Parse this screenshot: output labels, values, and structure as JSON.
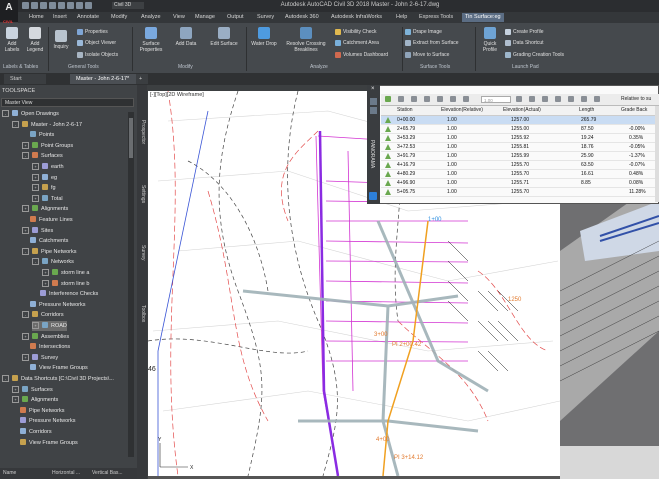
{
  "app": {
    "logo_text": "A",
    "logo_sub": "CIVIL",
    "qat_title": "Civil 3D",
    "title": "Autodesk AutoCAD Civil 3D 2018    Master - John 2-6-17.dwg"
  },
  "ribbon_tabs": [
    "Home",
    "Insert",
    "Annotate",
    "Modify",
    "Analyze",
    "View",
    "Manage",
    "Output",
    "Survey",
    "Autodesk 360",
    "Autodesk InfraWorks",
    "Help",
    "Express Tools",
    "Tin Surface:eg",
    ""
  ],
  "ribbon": {
    "add_labels": "Add Labels",
    "add_legend": "Add Legend",
    "inquiry": "Inquiry",
    "properties": "Properties",
    "object_viewer": "Object Viewer",
    "isolate_objects": "Isolate Objects",
    "surface_properties": "Surface Properties",
    "add_data": "Add Data",
    "edit_surface": "Edit Surface",
    "water_drop": "Water Drop",
    "resolve_crossing": "Resolve Crossing Breaklines",
    "visibility_check": "Visibility Check",
    "catchment_area": "Catchment Area",
    "volumes_dashboard": "Volumes Dashboard",
    "drape_image": "Drape Image",
    "extract_from_surface": "Extract from Surface",
    "move_to_surface": "Move to Surface",
    "quick_profile": "Quick Profile",
    "create_profile": "Create Profile",
    "data_shortcut": "Data Shortcut",
    "grading_creation": "Grading Creation Tools",
    "panels": {
      "labels_tables": "Labels & Tables",
      "general_tools": "General Tools",
      "modify": "Modify",
      "analyze": "Analyze",
      "surface_tools": "Surface Tools",
      "launch_pad": "Launch Pad"
    }
  },
  "doc_tabs": [
    "Start",
    "Master - John 2-6-17*",
    "+"
  ],
  "toolspace": {
    "title": "TOOLSPACE",
    "view": "Master View",
    "vtabs": [
      "Prospector",
      "Settings",
      "Survey",
      "Toolbox"
    ],
    "tree": [
      {
        "label": "Open Drawings",
        "indent": 0,
        "exp": "-"
      },
      {
        "label": "Master - John 2-6-17",
        "indent": 1,
        "exp": "-"
      },
      {
        "label": "Points",
        "indent": 2,
        "exp": ""
      },
      {
        "label": "Point Groups",
        "indent": 2,
        "exp": "+"
      },
      {
        "label": "Surfaces",
        "indent": 2,
        "exp": "-"
      },
      {
        "label": "earth",
        "indent": 3,
        "exp": "+"
      },
      {
        "label": "eg",
        "indent": 3,
        "exp": "+"
      },
      {
        "label": "fg",
        "indent": 3,
        "exp": "+"
      },
      {
        "label": "Total",
        "indent": 3,
        "exp": "+"
      },
      {
        "label": "Alignments",
        "indent": 2,
        "exp": "+"
      },
      {
        "label": "Feature Lines",
        "indent": 2,
        "exp": ""
      },
      {
        "label": "Sites",
        "indent": 2,
        "exp": "+"
      },
      {
        "label": "Catchments",
        "indent": 2,
        "exp": ""
      },
      {
        "label": "Pipe Networks",
        "indent": 2,
        "exp": "-"
      },
      {
        "label": "Networks",
        "indent": 3,
        "exp": "-"
      },
      {
        "label": "storm line a",
        "indent": 4,
        "exp": "+"
      },
      {
        "label": "storm line b",
        "indent": 4,
        "exp": "+"
      },
      {
        "label": "Interference Checks",
        "indent": 3,
        "exp": ""
      },
      {
        "label": "Pressure Networks",
        "indent": 2,
        "exp": ""
      },
      {
        "label": "Corridors",
        "indent": 2,
        "exp": "-"
      },
      {
        "label": "ROAD",
        "indent": 3,
        "exp": "+",
        "selected": true
      },
      {
        "label": "Assemblies",
        "indent": 2,
        "exp": "+"
      },
      {
        "label": "Intersections",
        "indent": 2,
        "exp": ""
      },
      {
        "label": "Survey",
        "indent": 2,
        "exp": "+"
      },
      {
        "label": "View Frame Groups",
        "indent": 2,
        "exp": ""
      },
      {
        "label": "Data Shortcuts [C:\\Civil 3D Projects\\...",
        "indent": 0,
        "exp": "-"
      },
      {
        "label": "Surfaces",
        "indent": 1,
        "exp": "+"
      },
      {
        "label": "Alignments",
        "indent": 1,
        "exp": "+"
      },
      {
        "label": "Pipe Networks",
        "indent": 1,
        "exp": ""
      },
      {
        "label": "Pressure Networks",
        "indent": 1,
        "exp": ""
      },
      {
        "label": "Corridors",
        "indent": 1,
        "exp": ""
      },
      {
        "label": "View Frame Groups",
        "indent": 1,
        "exp": ""
      }
    ],
    "bottom_cols": [
      "Name",
      "Horizontal ...",
      "Vertical Bas..."
    ]
  },
  "viewport": {
    "label": "[-][Top][2D Wireframe]",
    "coords": [
      "1250",
      "1255",
      "1260",
      "46",
      "3+00",
      "1+00",
      "4+00",
      "2+00",
      "PI 3+14.12",
      "PI 2+00.42"
    ]
  },
  "panorama": {
    "title": "PANORAMA",
    "search_placeholder": "1.00",
    "relative_label": "Relative to su",
    "columns": [
      "Station",
      "Elevation(Relative)",
      "Elevation(Actual)",
      "Length",
      "Grade Back"
    ],
    "rows": [
      [
        "0+00.00",
        "1.00",
        "1257.00",
        "265.79",
        ""
      ],
      [
        "2+65.79",
        "1.00",
        "1255.00",
        "87.50",
        "-0.00%"
      ],
      [
        "3+53.29",
        "1.00",
        "1255.92",
        "19.24",
        "0.35%"
      ],
      [
        "3+72.53",
        "1.00",
        "1255.81",
        "18.76",
        "-0.05%"
      ],
      [
        "3+91.79",
        "1.00",
        "1255.99",
        "25.90",
        "-1.37%"
      ],
      [
        "4+16.79",
        "1.00",
        "1255.70",
        "63.50",
        "-0.07%"
      ],
      [
        "4+80.29",
        "1.00",
        "1255.70",
        "16.61",
        "0.48%"
      ],
      [
        "4+96.90",
        "1.00",
        "1255.71",
        "8.85",
        "0.08%"
      ],
      [
        "5+05.75",
        "1.00",
        "1255.70",
        "",
        "11.28%"
      ]
    ]
  },
  "colors": {
    "accent": "#5b6d84",
    "dark": "#2b2d30",
    "panel": "#404346"
  }
}
